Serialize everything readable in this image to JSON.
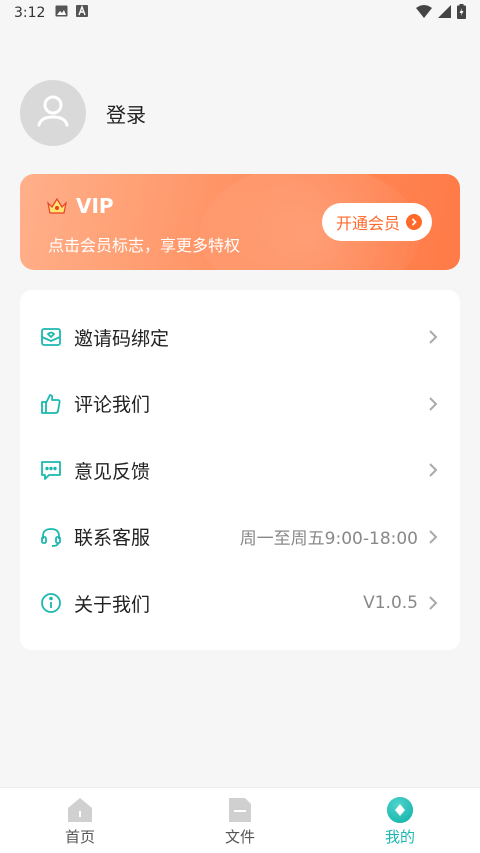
{
  "status_bar": {
    "time": "3:12"
  },
  "profile": {
    "login_label": "登录"
  },
  "vip": {
    "title": "VIP",
    "subtitle": "点击会员标志，享更多特权",
    "button_label": "开通会员"
  },
  "menu": {
    "items": [
      {
        "label": "邀请码绑定",
        "value": "",
        "icon": "invite-envelope-icon"
      },
      {
        "label": "评论我们",
        "value": "",
        "icon": "thumbs-up-icon"
      },
      {
        "label": "意见反馈",
        "value": "",
        "icon": "feedback-chat-icon"
      },
      {
        "label": "联系客服",
        "value": "周一至周五9:00-18:00",
        "icon": "headset-icon"
      },
      {
        "label": "关于我们",
        "value": "V1.0.5",
        "icon": "info-icon"
      }
    ]
  },
  "tabs": [
    {
      "label": "首页",
      "active": false
    },
    {
      "label": "文件",
      "active": false
    },
    {
      "label": "我的",
      "active": true
    }
  ],
  "colors": {
    "accent": "#1cb8b0",
    "vip_orange": "#ff7a46",
    "background": "#f6f6f6"
  }
}
